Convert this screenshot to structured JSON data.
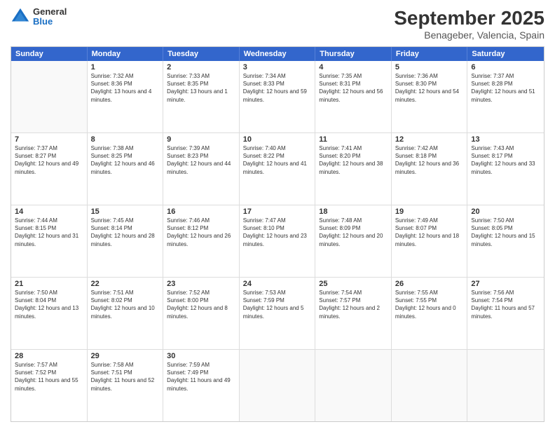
{
  "header": {
    "logo": {
      "general": "General",
      "blue": "Blue"
    },
    "month": "September 2025",
    "location": "Benageber, Valencia, Spain"
  },
  "days_of_week": [
    "Sunday",
    "Monday",
    "Tuesday",
    "Wednesday",
    "Thursday",
    "Friday",
    "Saturday"
  ],
  "weeks": [
    [
      {
        "day": "",
        "sunrise": "",
        "sunset": "",
        "daylight": ""
      },
      {
        "day": "1",
        "sunrise": "Sunrise: 7:32 AM",
        "sunset": "Sunset: 8:36 PM",
        "daylight": "Daylight: 13 hours and 4 minutes."
      },
      {
        "day": "2",
        "sunrise": "Sunrise: 7:33 AM",
        "sunset": "Sunset: 8:35 PM",
        "daylight": "Daylight: 13 hours and 1 minute."
      },
      {
        "day": "3",
        "sunrise": "Sunrise: 7:34 AM",
        "sunset": "Sunset: 8:33 PM",
        "daylight": "Daylight: 12 hours and 59 minutes."
      },
      {
        "day": "4",
        "sunrise": "Sunrise: 7:35 AM",
        "sunset": "Sunset: 8:31 PM",
        "daylight": "Daylight: 12 hours and 56 minutes."
      },
      {
        "day": "5",
        "sunrise": "Sunrise: 7:36 AM",
        "sunset": "Sunset: 8:30 PM",
        "daylight": "Daylight: 12 hours and 54 minutes."
      },
      {
        "day": "6",
        "sunrise": "Sunrise: 7:37 AM",
        "sunset": "Sunset: 8:28 PM",
        "daylight": "Daylight: 12 hours and 51 minutes."
      }
    ],
    [
      {
        "day": "7",
        "sunrise": "Sunrise: 7:37 AM",
        "sunset": "Sunset: 8:27 PM",
        "daylight": "Daylight: 12 hours and 49 minutes."
      },
      {
        "day": "8",
        "sunrise": "Sunrise: 7:38 AM",
        "sunset": "Sunset: 8:25 PM",
        "daylight": "Daylight: 12 hours and 46 minutes."
      },
      {
        "day": "9",
        "sunrise": "Sunrise: 7:39 AM",
        "sunset": "Sunset: 8:23 PM",
        "daylight": "Daylight: 12 hours and 44 minutes."
      },
      {
        "day": "10",
        "sunrise": "Sunrise: 7:40 AM",
        "sunset": "Sunset: 8:22 PM",
        "daylight": "Daylight: 12 hours and 41 minutes."
      },
      {
        "day": "11",
        "sunrise": "Sunrise: 7:41 AM",
        "sunset": "Sunset: 8:20 PM",
        "daylight": "Daylight: 12 hours and 38 minutes."
      },
      {
        "day": "12",
        "sunrise": "Sunrise: 7:42 AM",
        "sunset": "Sunset: 8:18 PM",
        "daylight": "Daylight: 12 hours and 36 minutes."
      },
      {
        "day": "13",
        "sunrise": "Sunrise: 7:43 AM",
        "sunset": "Sunset: 8:17 PM",
        "daylight": "Daylight: 12 hours and 33 minutes."
      }
    ],
    [
      {
        "day": "14",
        "sunrise": "Sunrise: 7:44 AM",
        "sunset": "Sunset: 8:15 PM",
        "daylight": "Daylight: 12 hours and 31 minutes."
      },
      {
        "day": "15",
        "sunrise": "Sunrise: 7:45 AM",
        "sunset": "Sunset: 8:14 PM",
        "daylight": "Daylight: 12 hours and 28 minutes."
      },
      {
        "day": "16",
        "sunrise": "Sunrise: 7:46 AM",
        "sunset": "Sunset: 8:12 PM",
        "daylight": "Daylight: 12 hours and 26 minutes."
      },
      {
        "day": "17",
        "sunrise": "Sunrise: 7:47 AM",
        "sunset": "Sunset: 8:10 PM",
        "daylight": "Daylight: 12 hours and 23 minutes."
      },
      {
        "day": "18",
        "sunrise": "Sunrise: 7:48 AM",
        "sunset": "Sunset: 8:09 PM",
        "daylight": "Daylight: 12 hours and 20 minutes."
      },
      {
        "day": "19",
        "sunrise": "Sunrise: 7:49 AM",
        "sunset": "Sunset: 8:07 PM",
        "daylight": "Daylight: 12 hours and 18 minutes."
      },
      {
        "day": "20",
        "sunrise": "Sunrise: 7:50 AM",
        "sunset": "Sunset: 8:05 PM",
        "daylight": "Daylight: 12 hours and 15 minutes."
      }
    ],
    [
      {
        "day": "21",
        "sunrise": "Sunrise: 7:50 AM",
        "sunset": "Sunset: 8:04 PM",
        "daylight": "Daylight: 12 hours and 13 minutes."
      },
      {
        "day": "22",
        "sunrise": "Sunrise: 7:51 AM",
        "sunset": "Sunset: 8:02 PM",
        "daylight": "Daylight: 12 hours and 10 minutes."
      },
      {
        "day": "23",
        "sunrise": "Sunrise: 7:52 AM",
        "sunset": "Sunset: 8:00 PM",
        "daylight": "Daylight: 12 hours and 8 minutes."
      },
      {
        "day": "24",
        "sunrise": "Sunrise: 7:53 AM",
        "sunset": "Sunset: 7:59 PM",
        "daylight": "Daylight: 12 hours and 5 minutes."
      },
      {
        "day": "25",
        "sunrise": "Sunrise: 7:54 AM",
        "sunset": "Sunset: 7:57 PM",
        "daylight": "Daylight: 12 hours and 2 minutes."
      },
      {
        "day": "26",
        "sunrise": "Sunrise: 7:55 AM",
        "sunset": "Sunset: 7:55 PM",
        "daylight": "Daylight: 12 hours and 0 minutes."
      },
      {
        "day": "27",
        "sunrise": "Sunrise: 7:56 AM",
        "sunset": "Sunset: 7:54 PM",
        "daylight": "Daylight: 11 hours and 57 minutes."
      }
    ],
    [
      {
        "day": "28",
        "sunrise": "Sunrise: 7:57 AM",
        "sunset": "Sunset: 7:52 PM",
        "daylight": "Daylight: 11 hours and 55 minutes."
      },
      {
        "day": "29",
        "sunrise": "Sunrise: 7:58 AM",
        "sunset": "Sunset: 7:51 PM",
        "daylight": "Daylight: 11 hours and 52 minutes."
      },
      {
        "day": "30",
        "sunrise": "Sunrise: 7:59 AM",
        "sunset": "Sunset: 7:49 PM",
        "daylight": "Daylight: 11 hours and 49 minutes."
      },
      {
        "day": "",
        "sunrise": "",
        "sunset": "",
        "daylight": ""
      },
      {
        "day": "",
        "sunrise": "",
        "sunset": "",
        "daylight": ""
      },
      {
        "day": "",
        "sunrise": "",
        "sunset": "",
        "daylight": ""
      },
      {
        "day": "",
        "sunrise": "",
        "sunset": "",
        "daylight": ""
      }
    ]
  ]
}
